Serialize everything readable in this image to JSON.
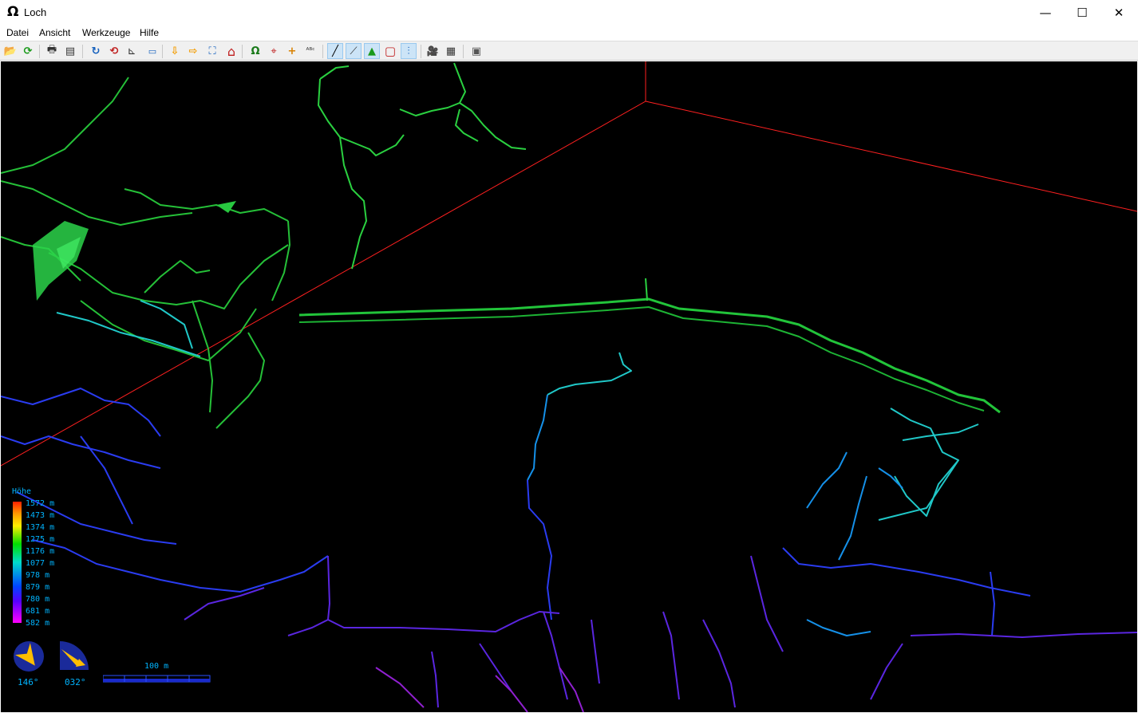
{
  "window": {
    "title": "Loch",
    "app_icon": "Ω",
    "minimize": "—",
    "maximize": "☐",
    "close": "✕"
  },
  "menu": {
    "items": [
      "Datei",
      "Ansicht",
      "Werkzeuge",
      "Hilfe"
    ]
  },
  "toolbar": {
    "icons": [
      "open-icon",
      "reload-icon",
      "print-icon",
      "export-icon",
      "rotate-icon",
      "rotate-stop-icon",
      "plan-elevation-icon",
      "move-down-icon",
      "move-right-icon",
      "fit-view-icon",
      "home-icon",
      "entrance-icon",
      "fixed-point-icon",
      "crosshair-icon",
      "labels-icon",
      "centreline-icon",
      "walls-icon",
      "surface-icon",
      "bounding-box-icon",
      "depth-icon",
      "video-icon",
      "log-icon",
      "fullscreen-icon"
    ],
    "glyphs": {
      "open": "📂",
      "reload": "⟳",
      "print": "🖶",
      "export": "▤",
      "rotate": "↻",
      "rotate_stop": "⟲",
      "plan": "⊾",
      "down": "⇩",
      "right": "⇨",
      "fit": "⛶",
      "home": "⌂",
      "entrance": "Ω",
      "fixed": "⌖",
      "cross": "+",
      "labels": "ᴬᴮᶜ",
      "centreline": "╱",
      "walls": "⟋",
      "surface": "▲",
      "box": "▢",
      "depth": "⫶",
      "video": "🎥",
      "log": "▦",
      "fullscreen": "▣"
    }
  },
  "legend": {
    "title": "Höhe",
    "values": [
      "1572 m",
      "1473 m",
      "1374 m",
      "1275 m",
      "1176 m",
      "1077 m",
      "978 m",
      "879 m",
      "780 m",
      "681 m",
      "582 m"
    ]
  },
  "compass": {
    "bearing": "146°",
    "tilt": "032°"
  },
  "scale": {
    "label": "100 m"
  },
  "colors": {
    "box_edge": "#ff2020",
    "legend_text": "#00b4ff",
    "background": "#000000"
  }
}
